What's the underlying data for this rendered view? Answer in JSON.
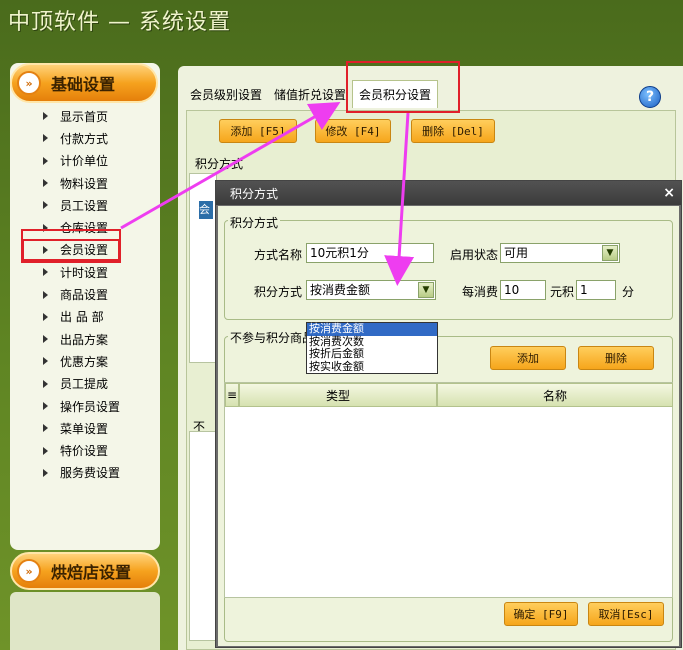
{
  "app": {
    "title": "中顶软件 — 系统设置"
  },
  "sidebar": {
    "header_label": "基础设置",
    "header_icon": "double-chevron-right-icon",
    "items": [
      {
        "label": "显示首页"
      },
      {
        "label": "付款方式"
      },
      {
        "label": "计价单位"
      },
      {
        "label": "物料设置"
      },
      {
        "label": "员工设置"
      },
      {
        "label": "仓库设置"
      },
      {
        "label": "会员设置"
      },
      {
        "label": "计时设置"
      },
      {
        "label": "商品设置"
      },
      {
        "label": "出 品 部"
      },
      {
        "label": "出品方案"
      },
      {
        "label": "优惠方案"
      },
      {
        "label": "员工提成"
      },
      {
        "label": "操作员设置"
      },
      {
        "label": "菜单设置"
      },
      {
        "label": "特价设置"
      },
      {
        "label": "服务费设置"
      }
    ],
    "bottom_label": "烘焙店设置"
  },
  "tabs": [
    {
      "label": "会员级别设置"
    },
    {
      "label": "储值折兑设置"
    },
    {
      "label": "会员积分设置"
    }
  ],
  "toolbar": {
    "add": "添加 [F5]",
    "edit": "修改 [F4]",
    "delete": "删除 [Del]"
  },
  "main": {
    "section_points": "积分方式",
    "row_marker": "会",
    "lower_marker": "不"
  },
  "dialog": {
    "title": "积分方式",
    "close": "×",
    "group_title": "积分方式",
    "name_label": "方式名称",
    "name_value": "10元积1分",
    "status_label": "启用状态",
    "status_value": "可用",
    "method_label": "积分方式",
    "method_value": "按消费金额",
    "per_spend_label": "每消费",
    "per_spend_value": "10",
    "yuan_label": "元积",
    "points_value": "1",
    "fen_label": "分",
    "dropdown_options": [
      "按消费金额",
      "按消费次数",
      "按折后金额",
      "按实收金额"
    ],
    "exclude_group_title": "不参与积分商品",
    "add_button": "添加",
    "delete_button": "删除",
    "columns": [
      "类型",
      "名称"
    ],
    "ok_button": "确定 [F9]",
    "cancel_button": "取消[Esc]"
  },
  "colors": {
    "accent_orange": "#f6a21e",
    "highlight_red": "#e0202a",
    "arrow_magenta": "#ee3df0",
    "selected_blue": "#316ac5"
  }
}
